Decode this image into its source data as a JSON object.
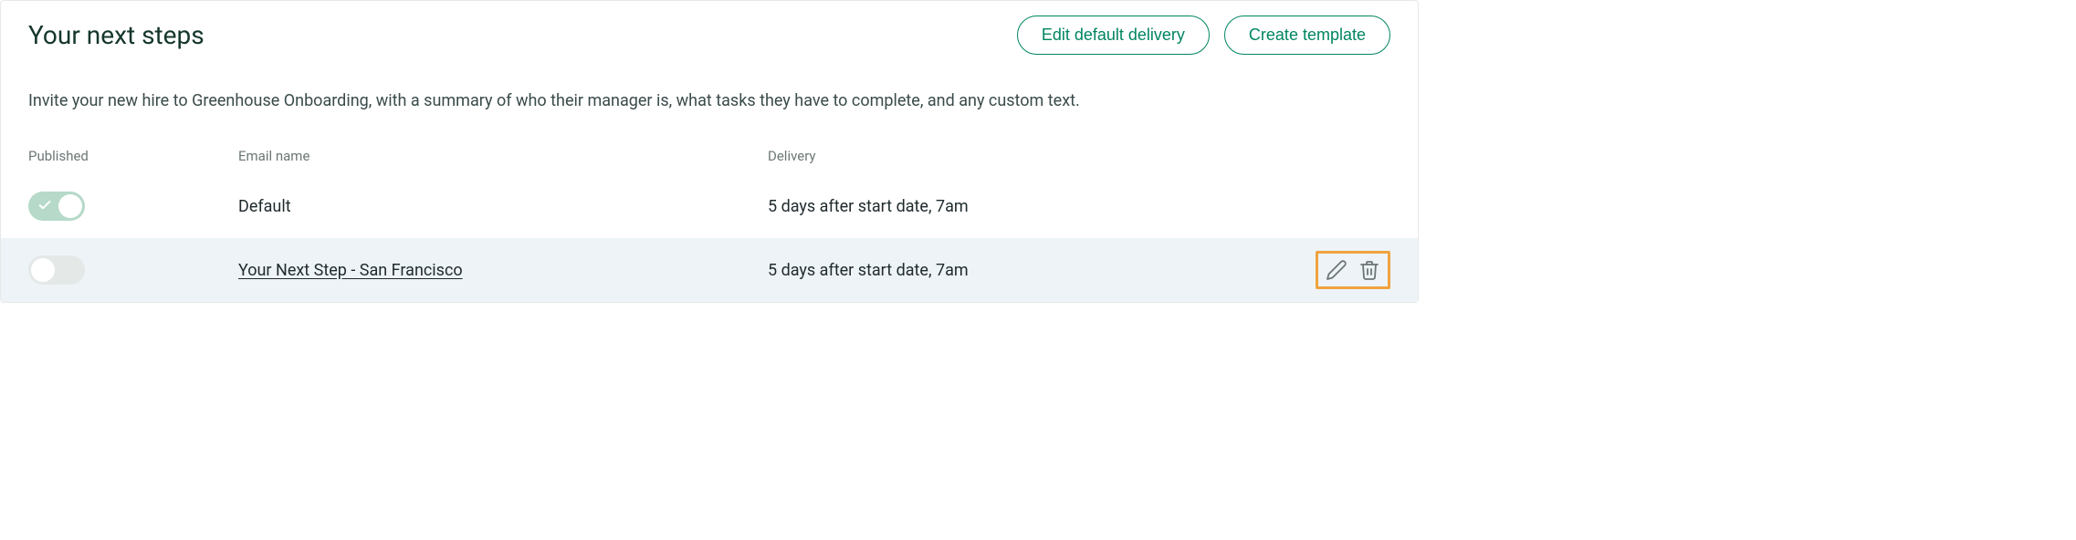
{
  "header": {
    "title": "Your next steps",
    "edit_default_label": "Edit default delivery",
    "create_template_label": "Create template"
  },
  "description": "Invite your new hire to Greenhouse Onboarding, with a summary of who their manager is, what tasks they have to complete, and any custom text.",
  "columns": {
    "published": "Published",
    "email_name": "Email name",
    "delivery": "Delivery"
  },
  "rows": [
    {
      "published": true,
      "email_name": "Default",
      "link": false,
      "delivery": "5 days after start date, 7am",
      "hovered": false,
      "show_actions": false
    },
    {
      "published": false,
      "email_name": "Your Next Step - San Francisco",
      "link": true,
      "delivery": "5 days after start date, 7am",
      "hovered": true,
      "show_actions": true
    }
  ]
}
